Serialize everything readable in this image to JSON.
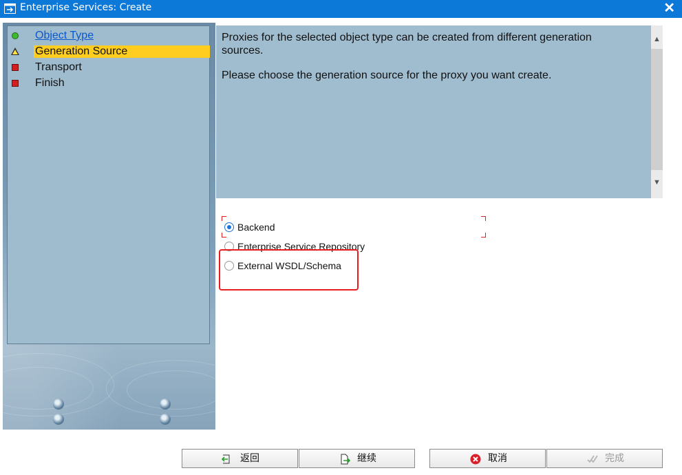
{
  "window": {
    "title": "Enterprise Services: Create",
    "close_label": "✕"
  },
  "steps": [
    {
      "label": "Object Type",
      "status": "done"
    },
    {
      "label": "Generation Source",
      "status": "current"
    },
    {
      "label": "Transport",
      "status": "pending"
    },
    {
      "label": "Finish",
      "status": "pending"
    }
  ],
  "description": {
    "line1": "Proxies for the selected object type can be created from different generation sources.",
    "line2": "Please choose the generation source for the proxy you want create."
  },
  "options": [
    {
      "label": "Backend",
      "selected": true
    },
    {
      "label": "Enterprise Service Repository",
      "selected": false
    },
    {
      "label": "External WSDL/Schema",
      "selected": false
    }
  ],
  "buttons": {
    "back": "返回",
    "continue": "继续",
    "cancel": "取消",
    "finish": "完成"
  },
  "colors": {
    "titlebar": "#0c78d7",
    "active_step": "#ffcd1f",
    "panel": "#a0bccf",
    "highlight": "#e81d1d"
  }
}
